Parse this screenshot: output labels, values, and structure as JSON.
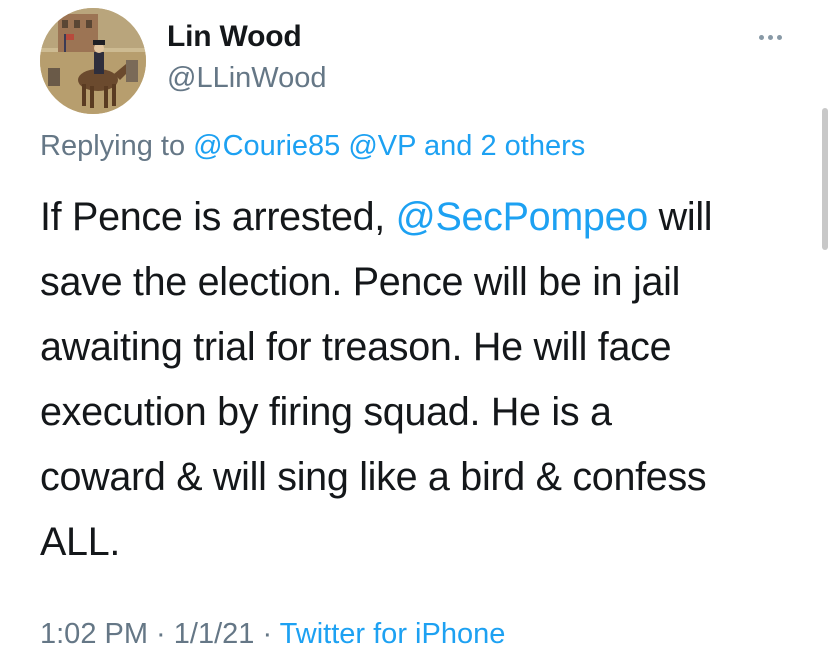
{
  "author": {
    "display_name": "Lin Wood",
    "handle": "@LLinWood",
    "avatar": "avatar-image-horse-rider-painting"
  },
  "reply": {
    "prefix": "Replying to",
    "mentions": [
      "@Courie85",
      "@VP"
    ],
    "others": "and 2 others"
  },
  "tweet": {
    "lines": [
      {
        "before": "If Pence is arrested, ",
        "mention": "@SecPompeo",
        "after": " will"
      },
      {
        "text": "save the election. Pence will be in jail"
      },
      {
        "text": "awaiting trial for treason. He will face"
      },
      {
        "text": "execution by firing squad. He is a"
      },
      {
        "text": "coward & will sing like a bird & confess"
      },
      {
        "text": "ALL."
      }
    ]
  },
  "meta": {
    "time": "1:02 PM",
    "separator": " · ",
    "date": "1/1/21",
    "source": "Twitter for iPhone"
  },
  "icons": {
    "more": "more-horizontal-icon"
  },
  "colors": {
    "text": "#14171a",
    "secondary": "#657786",
    "link": "#1da1f2"
  }
}
